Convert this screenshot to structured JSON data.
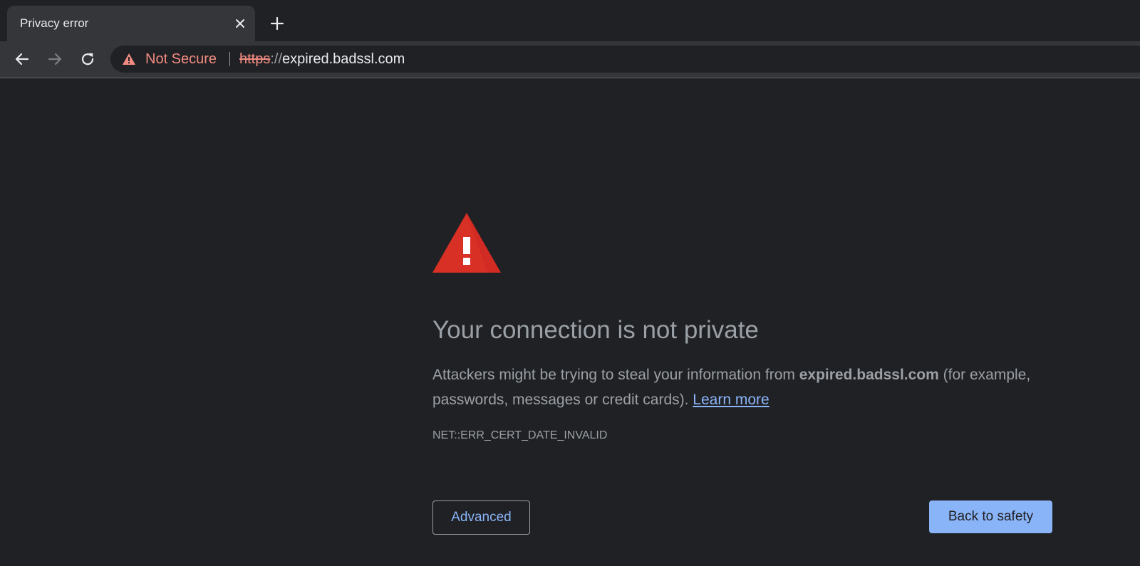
{
  "tab": {
    "title": "Privacy error",
    "close_icon": "close-icon",
    "new_tab_icon": "plus-icon"
  },
  "toolbar": {
    "back_icon": "arrow-left-icon",
    "forward_icon": "arrow-right-icon",
    "reload_icon": "reload-icon"
  },
  "omnibox": {
    "warning_icon": "warning-triangle-icon",
    "security_label": "Not Secure",
    "url_scheme": "https",
    "url_separator": "://",
    "url_host": "expired.badssl.com"
  },
  "interstitial": {
    "icon": "red-warning-triangle-icon",
    "heading": "Your connection is not private",
    "description_before": "Attackers might be trying to steal your information from ",
    "description_host": "expired.badssl.com",
    "description_after": " (for example, passwords, messages or credit cards). ",
    "learn_more_label": "Learn more",
    "error_code": "NET::ERR_CERT_DATE_INVALID",
    "advanced_label": "Advanced",
    "back_to_safety_label": "Back to safety"
  },
  "colors": {
    "background": "#202124",
    "toolbar": "#35363a",
    "not_secure_red": "#f28b82",
    "warning_red": "#d93025",
    "link_blue": "#8ab4f8",
    "text_gray": "#9aa0a6"
  }
}
